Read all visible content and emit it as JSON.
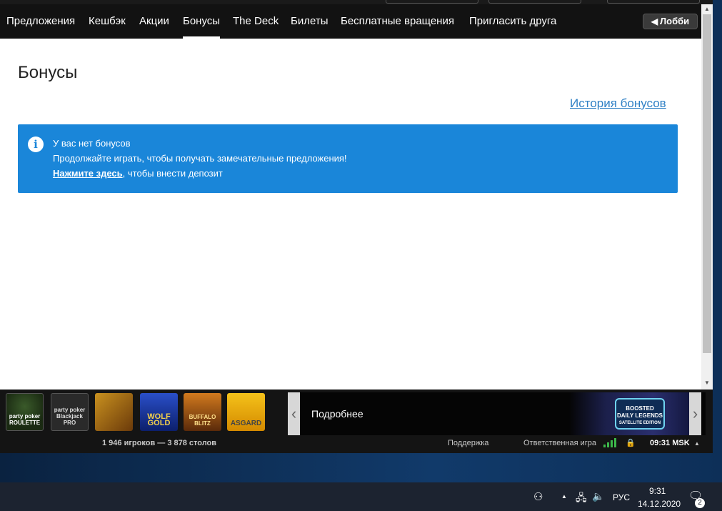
{
  "nav": {
    "items": [
      "Предложения",
      "Кешбэк",
      "Акции",
      "Бонусы",
      "The Deck",
      "Билеты",
      "Бесплатные вращения",
      "Пригласить друга"
    ],
    "active": "Бонусы",
    "lobby_label": "Лобби"
  },
  "page": {
    "title": "Бонусы",
    "history_link": "История бонусов"
  },
  "alert": {
    "icon": "info-icon",
    "line1": "У вас нет бонусов",
    "line2": "Продолжайте играть, чтобы получать замечательные предложения!",
    "link": "Нажмите здесь",
    "line3_rest": ", чтобы внести депозит",
    "color": "#1a86d9"
  },
  "games": [
    {
      "name": "roulette",
      "label": "party poker ROULETTE"
    },
    {
      "name": "blackjack",
      "label": "party poker Blackjack PRO"
    },
    {
      "name": "game3",
      "label": ""
    },
    {
      "name": "wolf-gold",
      "label": "WOLF GOLD"
    },
    {
      "name": "buffalo-blitz",
      "label": "BUFFALO BLITZ"
    },
    {
      "name": "asgard",
      "label": "ASGARD"
    }
  ],
  "promo": {
    "text": "Подробнее",
    "banner_line1": "BOOSTED",
    "banner_line2": "DAILY LEGENDS",
    "banner_line3": "SATELLITE EDITION"
  },
  "status": {
    "players": "1 946 игроков  —  3 878 столов",
    "support": "Поддержка",
    "responsible": "Ответственная игра",
    "time": "09:31 MSK"
  },
  "taskbar": {
    "lang": "РУС",
    "time": "9:31",
    "date": "14.12.2020",
    "notifications": "2"
  },
  "colors": {
    "accent": "#1a86d9",
    "nav_bg": "#121212",
    "link": "#2f80c5",
    "signal": "#3cb84a"
  }
}
